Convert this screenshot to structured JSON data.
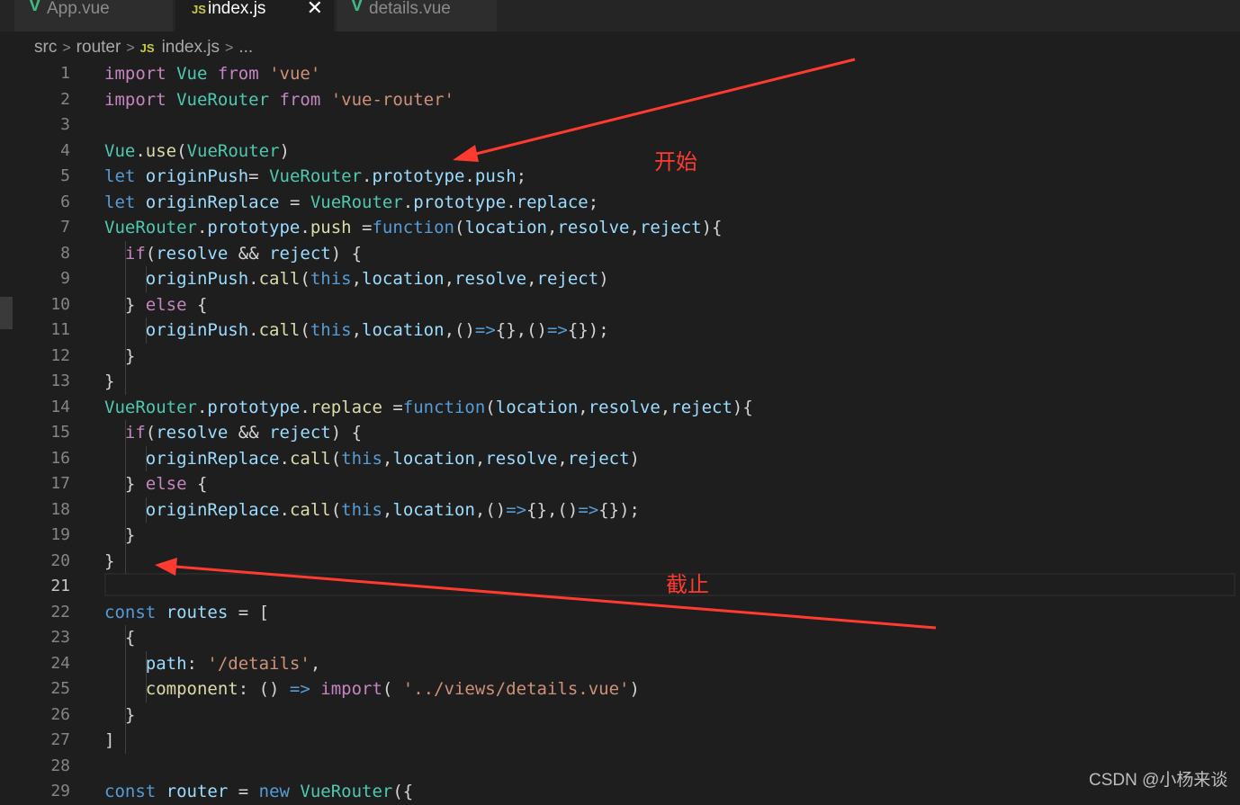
{
  "tabs": [
    {
      "label": "App.vue",
      "icon": "vue-icon",
      "active": false
    },
    {
      "label": "index.js",
      "icon": "js-icon",
      "active": true
    },
    {
      "label": "details.vue",
      "icon": "vue-icon",
      "active": false
    }
  ],
  "tab_close": "✕",
  "breadcrumb": {
    "parts": [
      "src",
      "router",
      "index.js",
      "..."
    ],
    "file_icon": "JS"
  },
  "icons": {
    "vue": "V",
    "js": "JS"
  },
  "editor": {
    "current_line": 21,
    "lines": [
      {
        "n": "1"
      },
      {
        "n": "2"
      },
      {
        "n": "3"
      },
      {
        "n": "4"
      },
      {
        "n": "5"
      },
      {
        "n": "6"
      },
      {
        "n": "7"
      },
      {
        "n": "8"
      },
      {
        "n": "9"
      },
      {
        "n": "10"
      },
      {
        "n": "11"
      },
      {
        "n": "12"
      },
      {
        "n": "13"
      },
      {
        "n": "14"
      },
      {
        "n": "15"
      },
      {
        "n": "16"
      },
      {
        "n": "17"
      },
      {
        "n": "18"
      },
      {
        "n": "19"
      },
      {
        "n": "20"
      },
      {
        "n": "21"
      },
      {
        "n": "22"
      },
      {
        "n": "23"
      },
      {
        "n": "24"
      },
      {
        "n": "25"
      },
      {
        "n": "26"
      },
      {
        "n": "27"
      },
      {
        "n": "28"
      },
      {
        "n": "29"
      }
    ],
    "code": [
      [
        [
          "k",
          "import"
        ],
        [
          "p",
          " "
        ],
        [
          "t",
          "Vue"
        ],
        [
          "p",
          " "
        ],
        [
          "k",
          "from"
        ],
        [
          "p",
          " "
        ],
        [
          "s",
          "'vue'"
        ]
      ],
      [
        [
          "k",
          "import"
        ],
        [
          "p",
          " "
        ],
        [
          "t",
          "VueRouter"
        ],
        [
          "p",
          " "
        ],
        [
          "k",
          "from"
        ],
        [
          "p",
          " "
        ],
        [
          "s",
          "'vue-router'"
        ]
      ],
      [],
      [
        [
          "t",
          "Vue"
        ],
        [
          "p",
          "."
        ],
        [
          "f",
          "use"
        ],
        [
          "p",
          "("
        ],
        [
          "t",
          "VueRouter"
        ],
        [
          "p",
          ")"
        ]
      ],
      [
        [
          "b",
          "let"
        ],
        [
          "p",
          " "
        ],
        [
          "v",
          "originPush"
        ],
        [
          "p",
          "= "
        ],
        [
          "t",
          "VueRouter"
        ],
        [
          "p",
          "."
        ],
        [
          "v",
          "prototype"
        ],
        [
          "p",
          "."
        ],
        [
          "v",
          "push"
        ],
        [
          "p",
          ";"
        ]
      ],
      [
        [
          "b",
          "let"
        ],
        [
          "p",
          " "
        ],
        [
          "v",
          "originReplace"
        ],
        [
          "p",
          " = "
        ],
        [
          "t",
          "VueRouter"
        ],
        [
          "p",
          "."
        ],
        [
          "v",
          "prototype"
        ],
        [
          "p",
          "."
        ],
        [
          "v",
          "replace"
        ],
        [
          "p",
          ";"
        ]
      ],
      [
        [
          "t",
          "VueRouter"
        ],
        [
          "p",
          "."
        ],
        [
          "v",
          "prototype"
        ],
        [
          "p",
          "."
        ],
        [
          "f",
          "push"
        ],
        [
          "p",
          " ="
        ],
        [
          "b",
          "function"
        ],
        [
          "p",
          "("
        ],
        [
          "v",
          "location"
        ],
        [
          "p",
          ","
        ],
        [
          "v",
          "resolve"
        ],
        [
          "p",
          ","
        ],
        [
          "v",
          "reject"
        ],
        [
          "p",
          "){"
        ]
      ],
      [
        [
          "p",
          "  "
        ],
        [
          "k",
          "if"
        ],
        [
          "p",
          "("
        ],
        [
          "v",
          "resolve"
        ],
        [
          "p",
          " && "
        ],
        [
          "v",
          "reject"
        ],
        [
          "p",
          ") {"
        ]
      ],
      [
        [
          "p",
          "    "
        ],
        [
          "v",
          "originPush"
        ],
        [
          "p",
          "."
        ],
        [
          "f",
          "call"
        ],
        [
          "p",
          "("
        ],
        [
          "b",
          "this"
        ],
        [
          "p",
          ","
        ],
        [
          "v",
          "location"
        ],
        [
          "p",
          ","
        ],
        [
          "v",
          "resolve"
        ],
        [
          "p",
          ","
        ],
        [
          "v",
          "reject"
        ],
        [
          "p",
          ")"
        ]
      ],
      [
        [
          "p",
          "  } "
        ],
        [
          "k",
          "else"
        ],
        [
          "p",
          " {"
        ]
      ],
      [
        [
          "p",
          "    "
        ],
        [
          "v",
          "originPush"
        ],
        [
          "p",
          "."
        ],
        [
          "f",
          "call"
        ],
        [
          "p",
          "("
        ],
        [
          "b",
          "this"
        ],
        [
          "p",
          ","
        ],
        [
          "v",
          "location"
        ],
        [
          "p",
          ",()"
        ],
        [
          "b",
          "=>"
        ],
        [
          "p",
          "{},()"
        ],
        [
          "b",
          "=>"
        ],
        [
          "p",
          "{});"
        ]
      ],
      [
        [
          "p",
          "  }"
        ]
      ],
      [
        [
          "p",
          "}"
        ]
      ],
      [
        [
          "t",
          "VueRouter"
        ],
        [
          "p",
          "."
        ],
        [
          "v",
          "prototype"
        ],
        [
          "p",
          "."
        ],
        [
          "f",
          "replace"
        ],
        [
          "p",
          " ="
        ],
        [
          "b",
          "function"
        ],
        [
          "p",
          "("
        ],
        [
          "v",
          "location"
        ],
        [
          "p",
          ","
        ],
        [
          "v",
          "resolve"
        ],
        [
          "p",
          ","
        ],
        [
          "v",
          "reject"
        ],
        [
          "p",
          "){"
        ]
      ],
      [
        [
          "p",
          "  "
        ],
        [
          "k",
          "if"
        ],
        [
          "p",
          "("
        ],
        [
          "v",
          "resolve"
        ],
        [
          "p",
          " && "
        ],
        [
          "v",
          "reject"
        ],
        [
          "p",
          ") {"
        ]
      ],
      [
        [
          "p",
          "    "
        ],
        [
          "v",
          "originReplace"
        ],
        [
          "p",
          "."
        ],
        [
          "f",
          "call"
        ],
        [
          "p",
          "("
        ],
        [
          "b",
          "this"
        ],
        [
          "p",
          ","
        ],
        [
          "v",
          "location"
        ],
        [
          "p",
          ","
        ],
        [
          "v",
          "resolve"
        ],
        [
          "p",
          ","
        ],
        [
          "v",
          "reject"
        ],
        [
          "p",
          ")"
        ]
      ],
      [
        [
          "p",
          "  } "
        ],
        [
          "k",
          "else"
        ],
        [
          "p",
          " {"
        ]
      ],
      [
        [
          "p",
          "    "
        ],
        [
          "v",
          "originReplace"
        ],
        [
          "p",
          "."
        ],
        [
          "f",
          "call"
        ],
        [
          "p",
          "("
        ],
        [
          "b",
          "this"
        ],
        [
          "p",
          ","
        ],
        [
          "v",
          "location"
        ],
        [
          "p",
          ",()"
        ],
        [
          "b",
          "=>"
        ],
        [
          "p",
          "{},()"
        ],
        [
          "b",
          "=>"
        ],
        [
          "p",
          "{});"
        ]
      ],
      [
        [
          "p",
          "  }"
        ]
      ],
      [
        [
          "p",
          "}"
        ]
      ],
      [],
      [
        [
          "b",
          "const"
        ],
        [
          "p",
          " "
        ],
        [
          "v",
          "routes"
        ],
        [
          "p",
          " = ["
        ]
      ],
      [
        [
          "p",
          "  {"
        ]
      ],
      [
        [
          "p",
          "    "
        ],
        [
          "v",
          "path"
        ],
        [
          "p",
          ": "
        ],
        [
          "s",
          "'/details'"
        ],
        [
          "p",
          ","
        ]
      ],
      [
        [
          "p",
          "    "
        ],
        [
          "f",
          "component"
        ],
        [
          "p",
          ": () "
        ],
        [
          "b",
          "=>"
        ],
        [
          "p",
          " "
        ],
        [
          "k",
          "import"
        ],
        [
          "p",
          "( "
        ],
        [
          "s",
          "'../views/details.vue'"
        ],
        [
          "p",
          ")"
        ]
      ],
      [
        [
          "p",
          "  }"
        ]
      ],
      [
        [
          "p",
          "]"
        ]
      ],
      [],
      [
        [
          "b",
          "const"
        ],
        [
          "p",
          " "
        ],
        [
          "v",
          "router"
        ],
        [
          "p",
          " = "
        ],
        [
          "b",
          "new"
        ],
        [
          "p",
          " "
        ],
        [
          "t",
          "VueRouter"
        ],
        [
          "p",
          "({"
        ]
      ]
    ]
  },
  "annotations": {
    "start": "开始",
    "end": "截止"
  },
  "arrow_color": "#ff3b30",
  "watermark": "CSDN @小杨来谈"
}
